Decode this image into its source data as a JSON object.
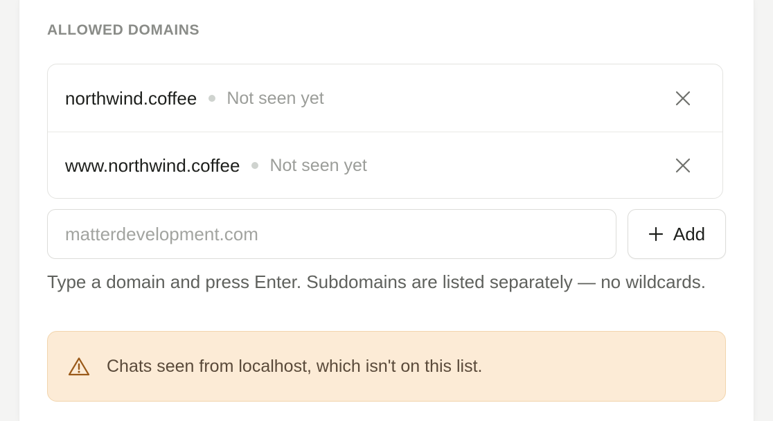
{
  "section": {
    "title": "ALLOWED DOMAINS"
  },
  "domains": [
    {
      "name": "northwind.coffee",
      "status": "Not seen yet"
    },
    {
      "name": "www.northwind.coffee",
      "status": "Not seen yet"
    }
  ],
  "input": {
    "placeholder": "matterdevelopment.com",
    "value": ""
  },
  "add_button": {
    "label": "Add",
    "icon": "plus-icon"
  },
  "hint": "Type a domain and press Enter. Subdomains are listed separately — no wildcards.",
  "warning": {
    "icon": "warning-triangle-icon",
    "text": "Chats seen from localhost, which isn't on this list."
  },
  "colors": {
    "warning_background": "#fcebd6",
    "warning_border": "#f2d5ad",
    "status_dot": "#cfd3cf"
  }
}
